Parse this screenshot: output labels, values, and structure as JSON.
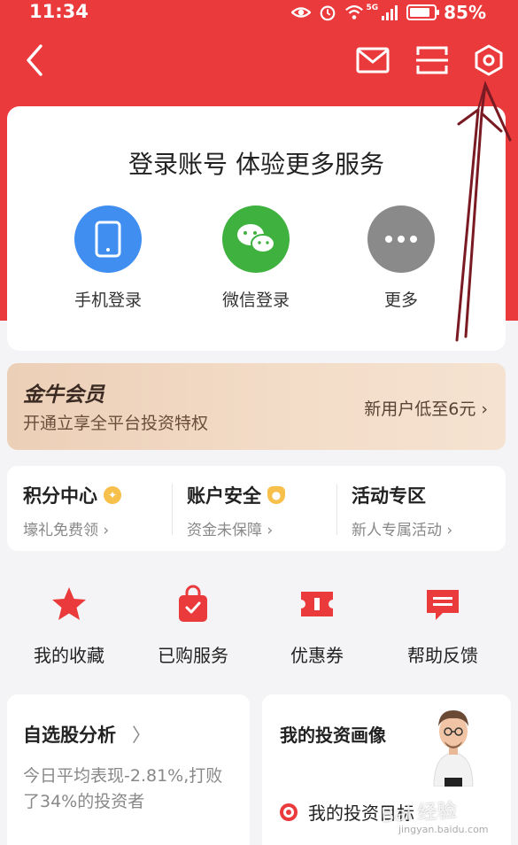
{
  "status": {
    "time": "11:34",
    "network": "5G",
    "battery": "85%"
  },
  "login": {
    "title": "登录账号 体验更多服务",
    "options": [
      {
        "label": "手机登录",
        "icon": "phone-icon",
        "color": "#3f8ef0"
      },
      {
        "label": "微信登录",
        "icon": "wechat-icon",
        "color": "#3fb13f"
      },
      {
        "label": "更多",
        "icon": "more-icon",
        "color": "#8a8a8a"
      }
    ]
  },
  "vip": {
    "title": "金牛会员",
    "subtitle": "开通立享全平台投资特权",
    "cta": "新用户低至6元 ›"
  },
  "points": [
    {
      "title": "积分中心",
      "sub": "壕礼免费领 ›",
      "badge": "star"
    },
    {
      "title": "账户安全",
      "sub": "资金未保障 ›",
      "badge": "shield"
    },
    {
      "title": "活动专区",
      "sub": "新人专属活动 ›",
      "badge": ""
    }
  ],
  "quick": [
    {
      "label": "我的收藏",
      "icon": "star-icon"
    },
    {
      "label": "已购服务",
      "icon": "shopping-bag-icon"
    },
    {
      "label": "优惠券",
      "icon": "coupon-icon"
    },
    {
      "label": "帮助反馈",
      "icon": "feedback-icon"
    }
  ],
  "analysis": {
    "title": "自选股分析",
    "chevron": "〉",
    "text": "今日平均表现-2.81%,打败了34%的投资者"
  },
  "portrait": {
    "title": "我的投资画像",
    "item": "我的投资目标"
  },
  "watermark": {
    "text": "Bai 经验",
    "sub": "jingyan.baidu.com"
  },
  "colors": {
    "brand_red": "#ea3a3c",
    "background": "#f4f4f6",
    "annotation_arrow": "#7a1a22"
  }
}
